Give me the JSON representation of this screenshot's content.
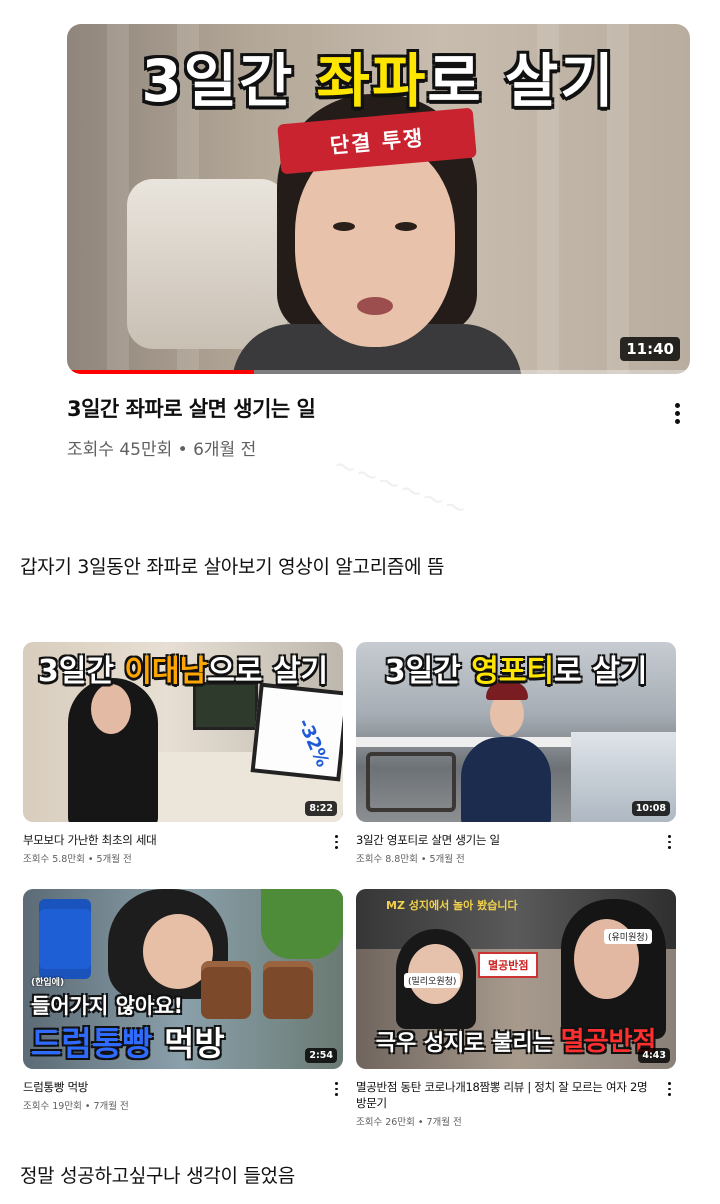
{
  "main_video": {
    "thumbnail_title": {
      "part1": "3일간 ",
      "highlight": "좌파",
      "part2": "로 살기"
    },
    "headband_text": "단결  투쟁",
    "duration": "11:40",
    "progress_fraction": 0.3,
    "title": "3일간 좌파로 살면 생기는 일",
    "meta": "조회수 45만회 • 6개월 전"
  },
  "caption_1": "갑자기 3일동안 좌파로 살아보기 영상이 알고리즘에 뜸",
  "caption_2": "정말 성공하고싶구나 생각이 들었음",
  "cards": [
    {
      "thumb_title": {
        "part1": "3일간 ",
        "highlight": "이대남",
        "part2": "으로 살기"
      },
      "thumb_extra": "-32%",
      "duration": "8:22",
      "title": "부모보다 가난한 최초의 세대",
      "meta": "조회수 5.8만회 • 5개월 전"
    },
    {
      "thumb_title": {
        "part1": "3일간 ",
        "highlight": "영포티",
        "part2": "로 살기"
      },
      "duration": "10:08",
      "title": "3일간 영포티로 살면 생기는 일",
      "meta": "조회수 8.8만회 • 5개월 전"
    },
    {
      "thumb_small": "(한입에)",
      "thumb_line1": "들어가지 않아요!",
      "thumb_line2": {
        "blue": "드럼통빵",
        "white": " 먹방"
      },
      "duration": "2:54",
      "title": "드럼통빵 먹방",
      "meta": "조회수 19만회 • 7개월 전"
    },
    {
      "thumb_top": "MZ 성지에서 놀아 봤습니다",
      "thumb_tag_left": "(밀리오원청)",
      "thumb_tag_right": "(유미원청)",
      "thumb_sign": "멸공반점",
      "thumb_bottom": {
        "white": "극우 성지로 불리는 ",
        "red": "멸공반점"
      },
      "duration": "4:43",
      "title": "멸공반점 동탄 코로나개18짬뽕 리뷰 | 정치 잘 모르는 여자 2명 방문기",
      "meta": "조회수 26만회 • 7개월 전"
    }
  ],
  "colors": {
    "progress": "#ff0000",
    "text_primary": "#0f0f0f",
    "text_secondary": "#606060",
    "highlight_yellow": "#ffe600"
  }
}
